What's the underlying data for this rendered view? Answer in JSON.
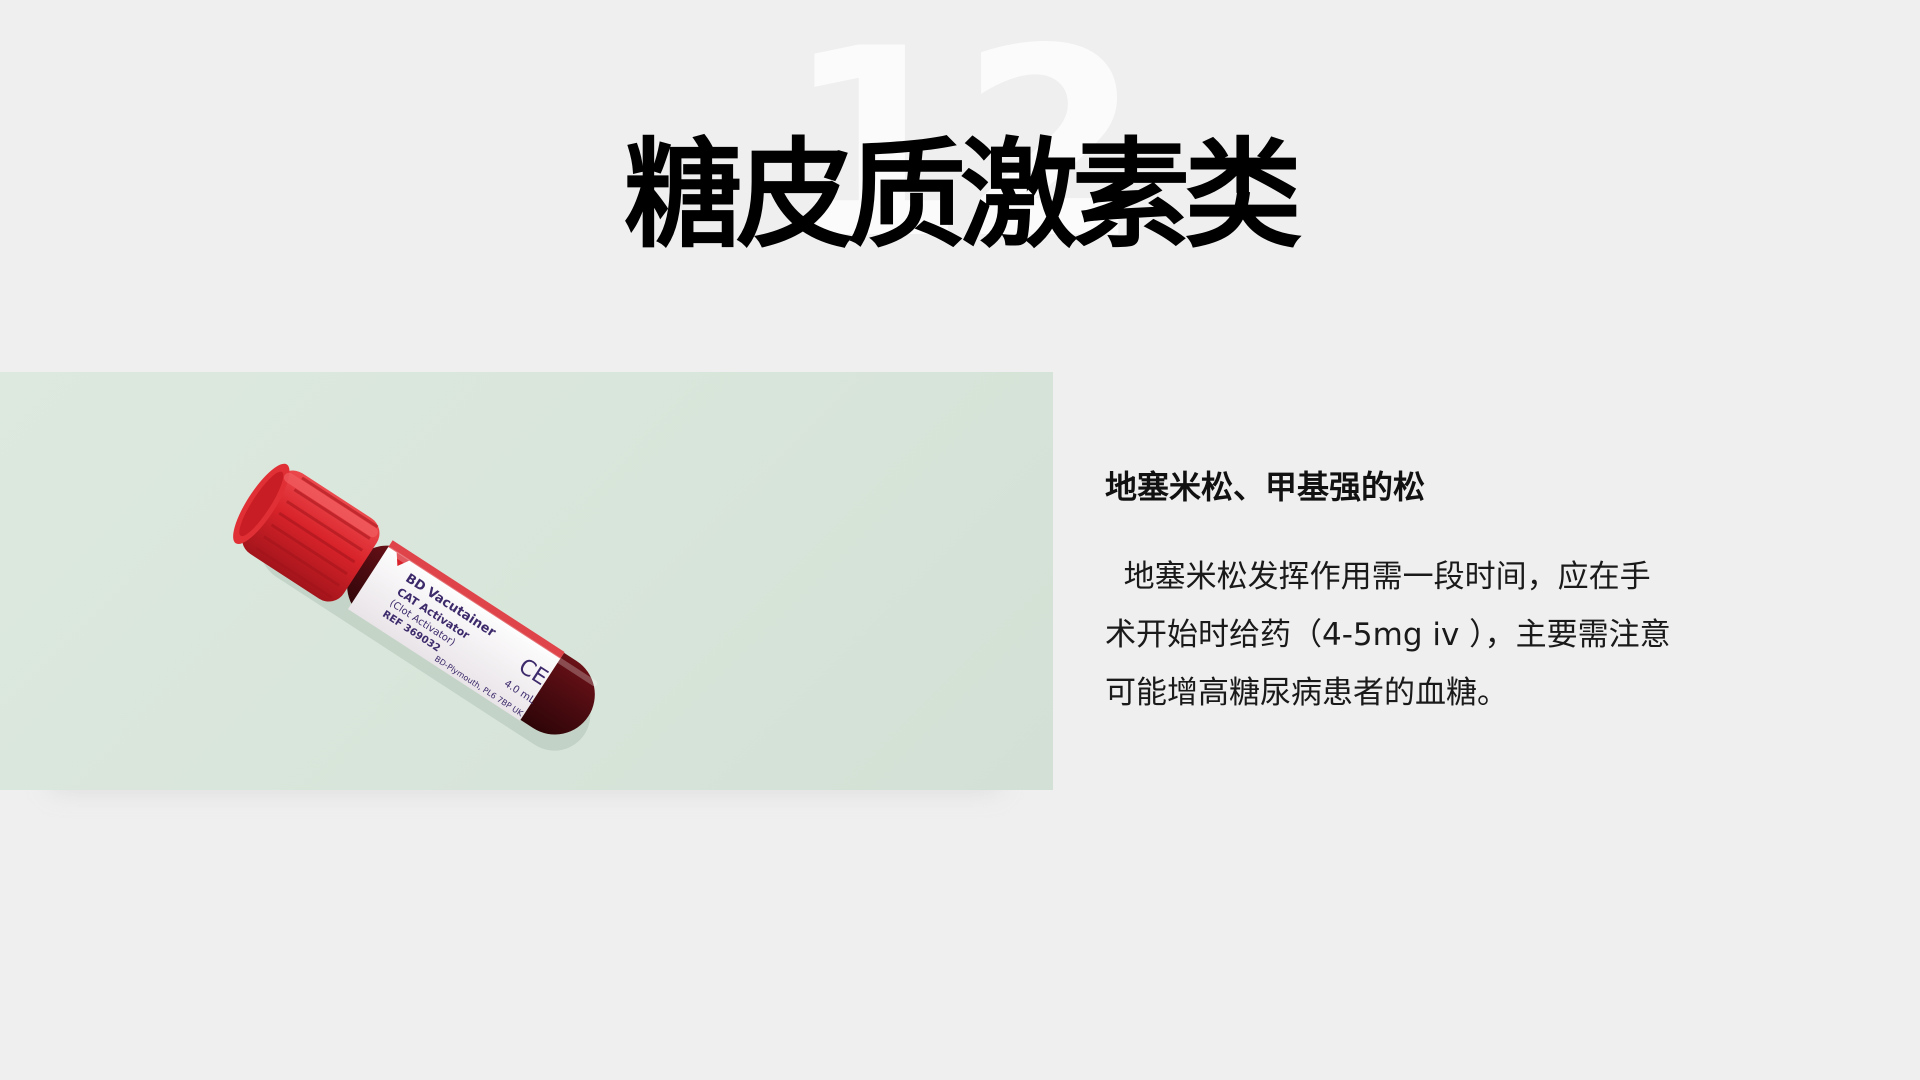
{
  "slide": {
    "background_number": "12",
    "title": "糖皮质激素类",
    "subtitle": "地塞米松、甲基强的松",
    "body": "地塞米松发挥作用需一段时间，应在手术开始时给药（4-5mg iv ），主要需注意可能增高糖尿病患者的血糖。"
  },
  "image": {
    "icon": "blood-sample-tube",
    "tube_label_lines": [
      "BD Vacutainer",
      "CAT Activator",
      "(Clot Activator)",
      "REF 369032",
      "BD-Plymouth, PL6 7BP UK",
      "CE",
      "4.0 mL"
    ]
  },
  "colors": {
    "background": "#efefef",
    "photo_background": "#d8e5da",
    "cap_red": "#d8232a",
    "blood": "#4a0b10"
  }
}
